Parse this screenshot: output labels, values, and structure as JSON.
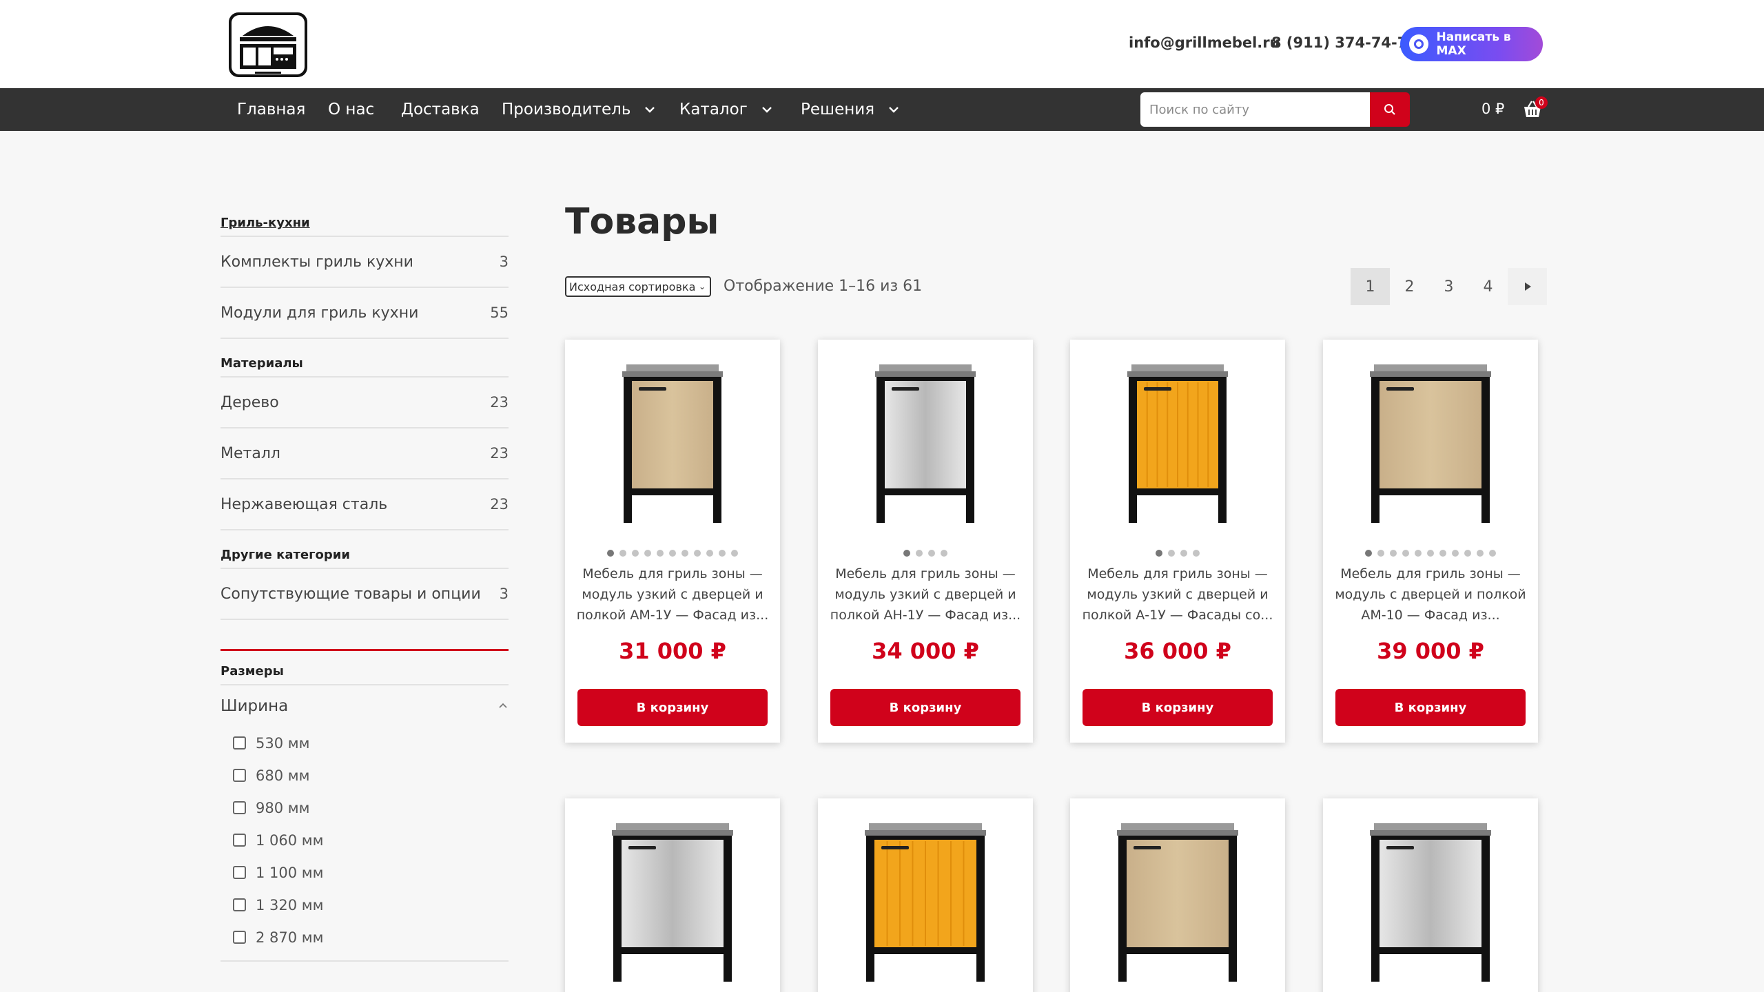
{
  "header": {
    "email": "info@grillmebel.ru",
    "phone": "8 (911) 374-74-74",
    "max_button": "Написать в MAX"
  },
  "nav": {
    "items": [
      "Главная",
      "О нас",
      "Доставка",
      "Производитель",
      "Каталог",
      "Решения"
    ],
    "search_placeholder": "Поиск по сайту",
    "cart_total": "0 ₽",
    "cart_count": "0"
  },
  "sidebar": {
    "grill_heading": "Гриль-кухни",
    "grill_items": [
      {
        "label": "Комплекты гриль кухни",
        "count": "3"
      },
      {
        "label": "Модули для гриль кухни",
        "count": "55"
      }
    ],
    "materials_heading": "Материалы",
    "materials_items": [
      {
        "label": "Дерево",
        "count": "23"
      },
      {
        "label": "Металл",
        "count": "23"
      },
      {
        "label": "Нержавеющая сталь",
        "count": "23"
      }
    ],
    "other_heading": "Другие категории",
    "other_items": [
      {
        "label": "Сопутствующие товары и опции",
        "count": "3"
      }
    ],
    "sizes_heading": "Размеры",
    "width_title": "Ширина",
    "width_options": [
      "530 мм",
      "680 мм",
      "980 мм",
      "1 060 мм",
      "1 100 мм",
      "1 320 мм",
      "2 870 мм"
    ]
  },
  "main": {
    "title": "Товары",
    "sort_label": "Исходная сортировка",
    "results": "Отображение 1–16 из 61",
    "pages": [
      "1",
      "2",
      "3",
      "4"
    ]
  },
  "products": [
    {
      "title": "Мебель для гриль зоны — модуль узкий с дверцей и полкой АМ-1У — Фасад из...",
      "price": "31 000 ₽",
      "button": "В корзину",
      "front": "beige",
      "dots": 11
    },
    {
      "title": "Мебель для гриль зоны — модуль узкий с дверцей и полкой АН-1У — Фасад из...",
      "price": "34 000 ₽",
      "button": "В корзину",
      "front": "steel",
      "dots": 4
    },
    {
      "title": "Мебель для гриль зоны — модуль узкий с дверцей и полкой А-1У — Фасады со...",
      "price": "36 000 ₽",
      "button": "В корзину",
      "front": "orange",
      "dots": 4
    },
    {
      "title": "Мебель для гриль зоны — модуль с дверцей и полкой АМ-10 — Фасад из...",
      "price": "39 000 ₽",
      "button": "В корзину",
      "front": "beige-wide",
      "dots": 11
    },
    {
      "front": "steel-wide"
    },
    {
      "front": "orange-wide"
    },
    {
      "front": "beige-wide"
    },
    {
      "front": "steel-wide"
    }
  ],
  "colors": {
    "accent": "#d0021b",
    "nav_bg": "#333333",
    "max_gradient": "#3b5bff"
  }
}
